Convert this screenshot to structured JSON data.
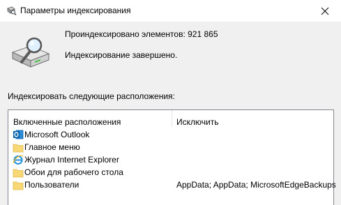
{
  "window": {
    "title": "Параметры индексирования",
    "title_icon": "indexing-options-icon",
    "close_icon": "close-icon"
  },
  "summary": {
    "indexed_count": "Проиндексировано элементов: 921 865",
    "status": "Индексирование завершено.",
    "icon": "drive-search-icon"
  },
  "locations": {
    "section_label": "Индексировать следующие расположения:",
    "col_included": "Включенные расположения",
    "col_exclude": "Исключить",
    "rows": [
      {
        "label": "Microsoft Outlook",
        "icon": "outlook-icon",
        "exclude": ""
      },
      {
        "label": "Главное меню",
        "icon": "folder-icon",
        "exclude": ""
      },
      {
        "label": "Журнал Internet Explorer",
        "icon": "internet-explorer-icon",
        "exclude": ""
      },
      {
        "label": "Обои для рабочего стола",
        "icon": "folder-icon",
        "exclude": ""
      },
      {
        "label": "Пользователи",
        "icon": "folder-icon",
        "exclude": "AppData; AppData; MicrosoftEdgeBackups"
      }
    ]
  },
  "colors": {
    "titlebar": "#ffffff",
    "window_background": "#f0f0f0",
    "folder": "#f8d775",
    "outlook_blue": "#0a64ad",
    "ie_blue": "#1e90e0"
  }
}
